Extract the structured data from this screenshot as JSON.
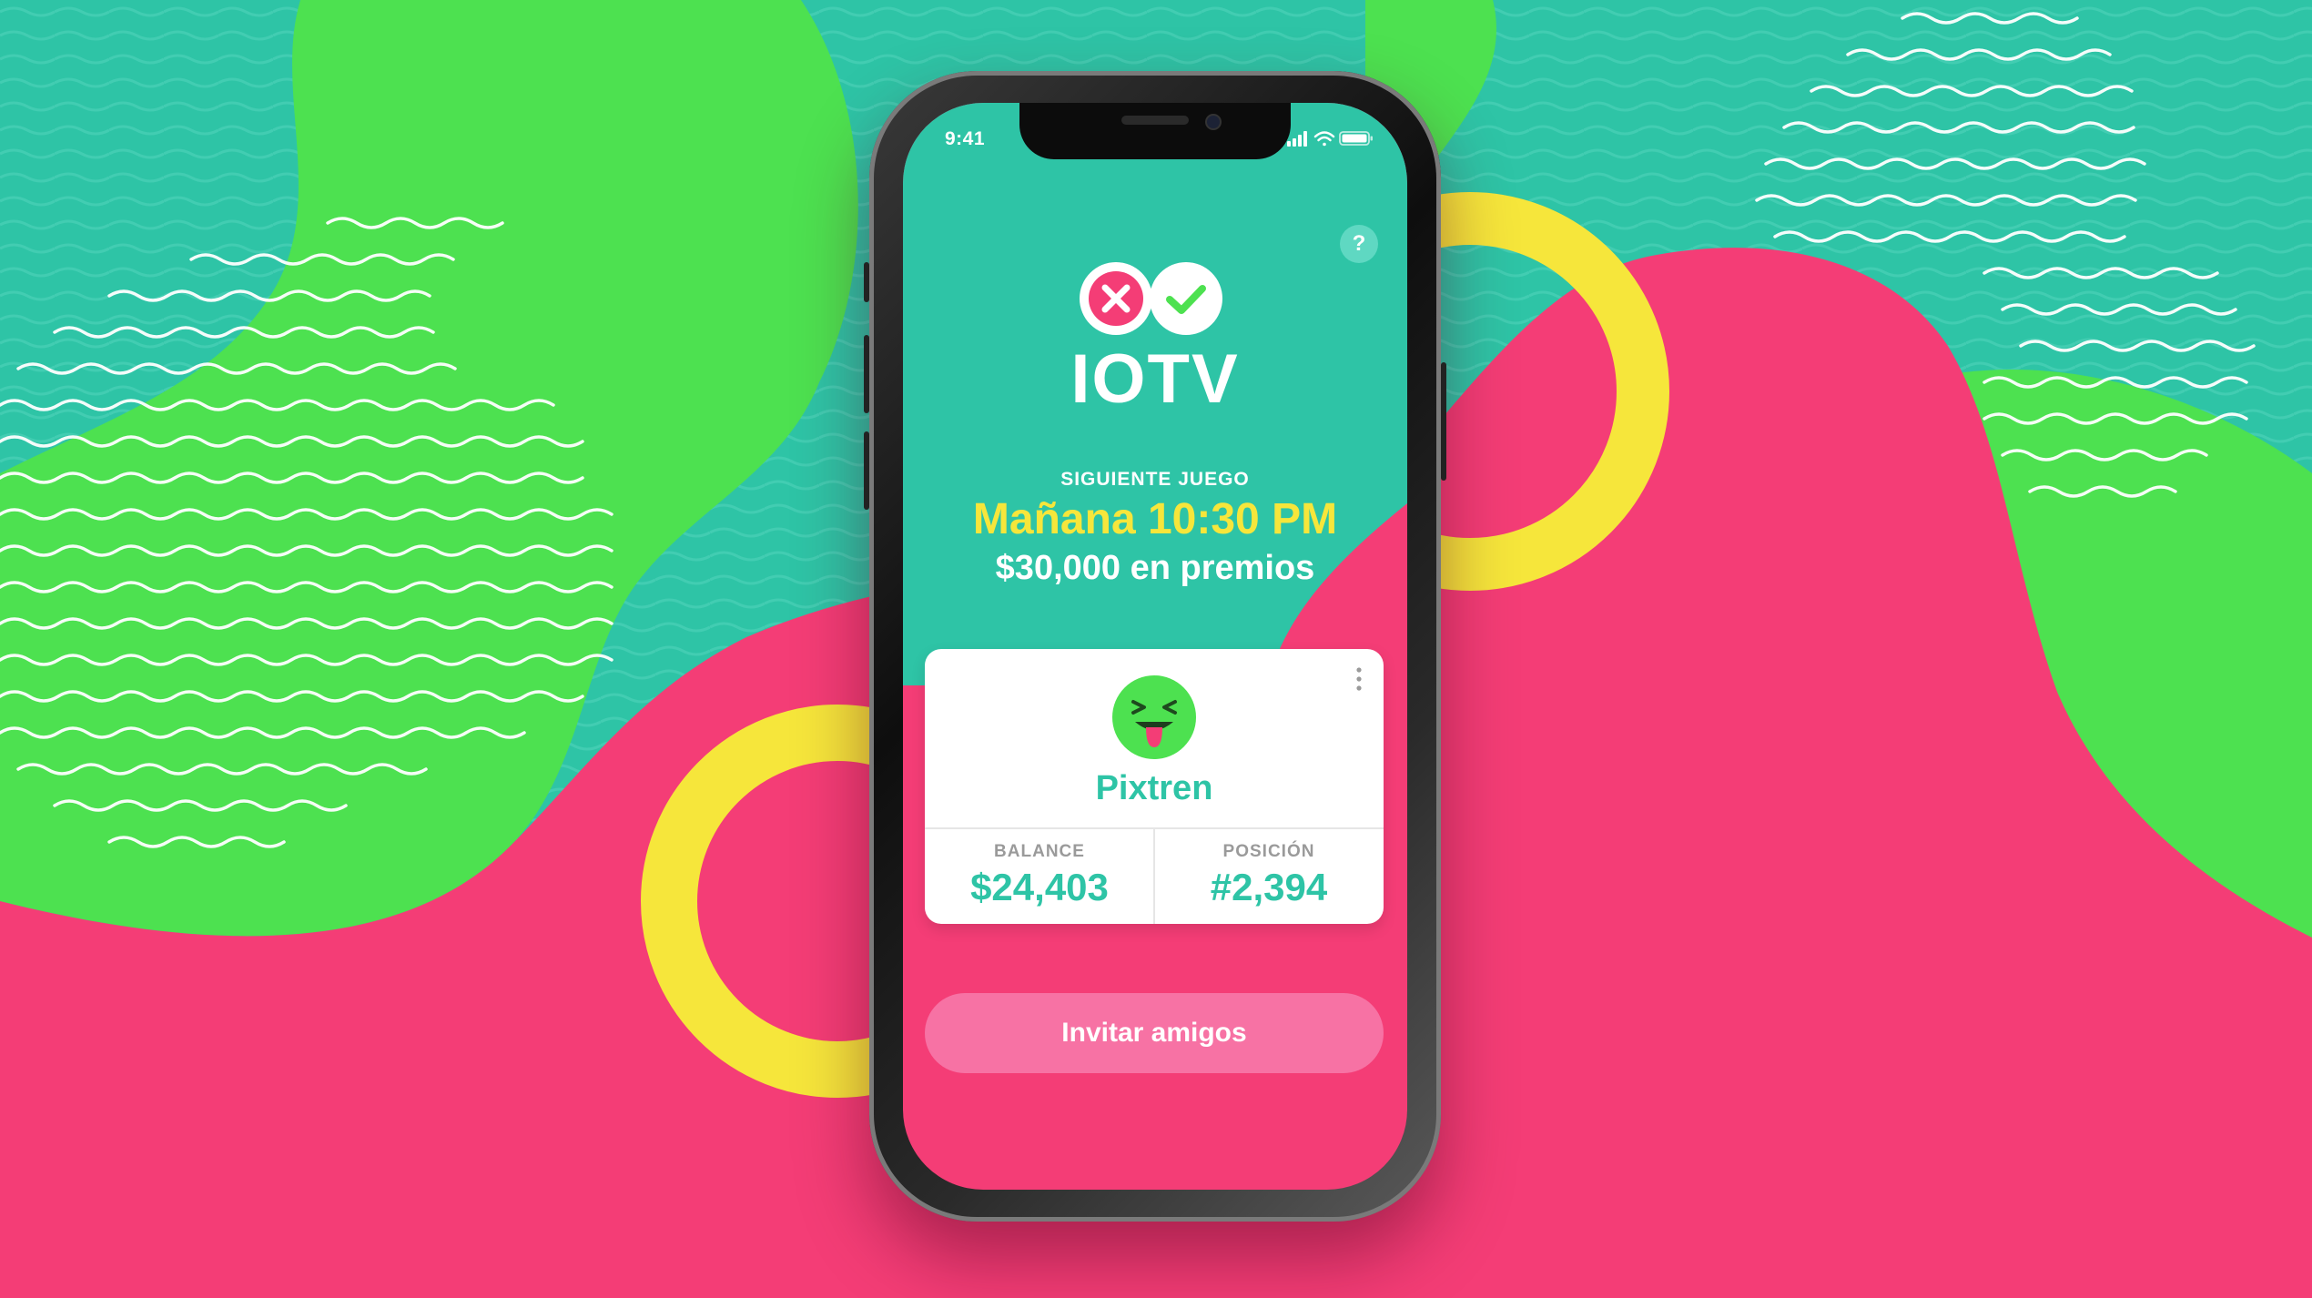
{
  "colors": {
    "teal": "#2ec4a6",
    "green": "#4de150",
    "pink": "#f43d76",
    "yellow": "#f6e63b",
    "invite_button": "#f772a4"
  },
  "status_bar": {
    "time": "9:41",
    "icons": [
      "signal-icon",
      "wifi-icon",
      "battery-icon"
    ]
  },
  "header": {
    "help_label": "?",
    "logo_icons": [
      "x-mark-icon",
      "check-mark-icon"
    ],
    "app_title": "IOTV"
  },
  "next_game": {
    "label": "SIGUIENTE JUEGO",
    "time": "Mañana 10:30 PM",
    "prize": "$30,000 en premios"
  },
  "profile_card": {
    "avatar_icon": "tongue-out-emoji-icon",
    "menu_icon": "more-vertical-icon",
    "username": "Pixtren",
    "stats": [
      {
        "label": "BALANCE",
        "value": "$24,403"
      },
      {
        "label": "POSICIÓN",
        "value": "#2,394"
      }
    ]
  },
  "invite_button": {
    "label": "Invitar amigos"
  }
}
